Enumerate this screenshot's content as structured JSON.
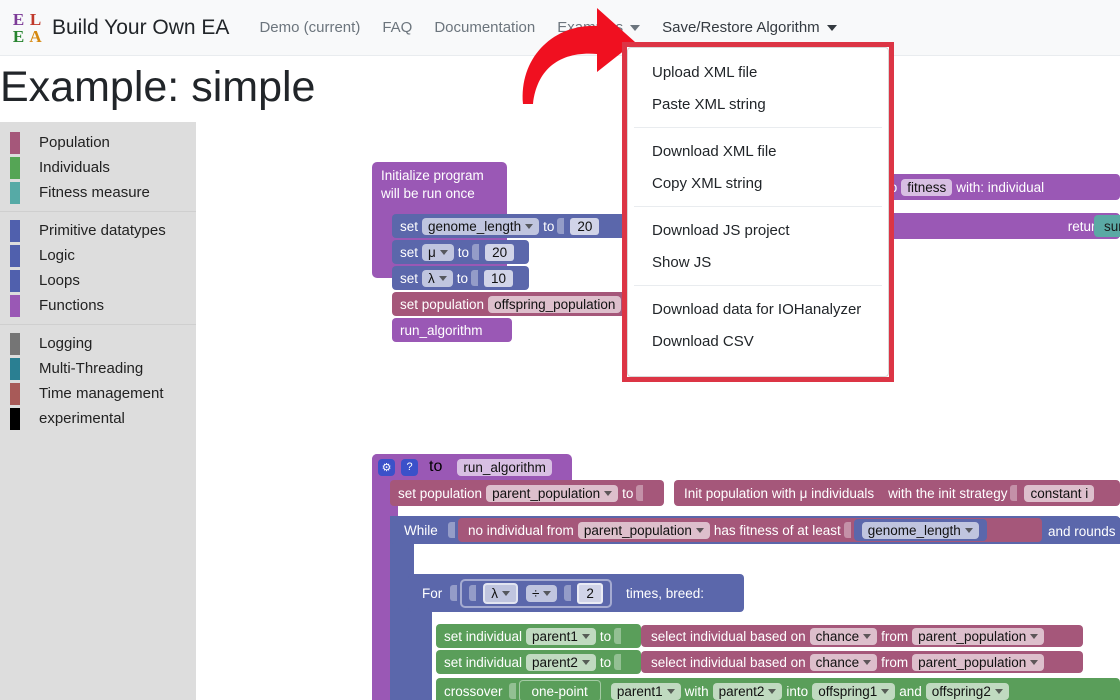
{
  "navbar": {
    "logo_letters": [
      {
        "ch": "E",
        "color": "#7d3c98"
      },
      {
        "ch": "L",
        "color": "#c0392b"
      },
      {
        "ch": "E",
        "color": "#27842f"
      },
      {
        "ch": "A",
        "color": "#d68910"
      }
    ],
    "brand": "Build Your Own EA",
    "links": [
      {
        "label": "Demo (current)",
        "dropdown": false
      },
      {
        "label": "FAQ",
        "dropdown": false
      },
      {
        "label": "Documentation",
        "dropdown": false
      },
      {
        "label": "Examples",
        "dropdown": true
      },
      {
        "label": "Save/Restore Algorithm",
        "dropdown": true
      }
    ]
  },
  "page": {
    "title": "Example: simple"
  },
  "dropdown": {
    "groups": [
      [
        "Upload XML file",
        "Paste XML string"
      ],
      [
        "Download XML file",
        "Copy XML string"
      ],
      [
        "Download JS project",
        "Show JS"
      ],
      [
        "Download data for IOHanalyzer",
        "Download CSV"
      ]
    ],
    "highlight_color": "#dc3545"
  },
  "sidebar": {
    "groups": [
      [
        {
          "label": "Population",
          "color": "#a5577a"
        },
        {
          "label": "Individuals",
          "color": "#55a555"
        },
        {
          "label": "Fitness measure",
          "color": "#56aaa6"
        }
      ],
      [
        {
          "label": "Primitive datatypes",
          "color": "#5060ad"
        },
        {
          "label": "Logic",
          "color": "#5060ad"
        },
        {
          "label": "Loops",
          "color": "#5060ad"
        },
        {
          "label": "Functions",
          "color": "#9a58b5"
        }
      ],
      [
        {
          "label": "Logging",
          "color": "#757575"
        },
        {
          "label": "Multi-Threading",
          "color": "#2a7f92"
        },
        {
          "label": "Time management",
          "color": "#a85a58"
        },
        {
          "label": "experimental",
          "color": "#000000"
        }
      ]
    ]
  },
  "workspace": {
    "init_block": {
      "title_line1": "Initialize program",
      "title_line2": "will be run once",
      "rows": {
        "set1_kw": "set",
        "set1_var": "genome_length",
        "set1_to": "to",
        "set1_val": "20",
        "set2_kw": "set",
        "set2_var": "μ",
        "set2_to": "to",
        "set2_val": "20",
        "set3_kw": "set",
        "set3_var": "λ",
        "set3_to": "to",
        "set3_val": "10",
        "setpop_kw": "set population",
        "setpop_var": "offspring_population",
        "call": "run_algorithm"
      }
    },
    "fitness_block": {
      "to": "to",
      "name": "fitness",
      "with": "with: individual"
    },
    "return_block": {
      "return": "return",
      "value": "sum"
    },
    "run_block": {
      "header_to": "to",
      "header_name": "run_algorithm",
      "setpop_kw": "set population",
      "setpop_var": "parent_population",
      "setpop_to": "to",
      "init_pop_text": "Init population with μ individuals",
      "init_strategy_label": "with the init strategy",
      "init_strategy_value": "constant i",
      "while_kw": "While",
      "while_cond_a": "no individual from",
      "while_cond_var": "parent_population",
      "while_cond_b": "has fitness of at least",
      "while_cond_val": "genome_length",
      "while_tail": "and rounds l",
      "for_kw": "For",
      "for_var": "λ",
      "for_op": "÷",
      "for_num": "2",
      "for_tail": "times, breed:",
      "sel1_kw": "set individual",
      "sel1_var": "parent1",
      "sel1_to": "to",
      "sel1_expr": "select individual based on",
      "sel1_mode": "chance",
      "sel1_from": "from",
      "sel1_src": "parent_population",
      "sel2_kw": "set individual",
      "sel2_var": "parent2",
      "sel2_to": "to",
      "sel2_expr": "select individual based on",
      "sel2_mode": "chance",
      "sel2_from": "from",
      "sel2_src": "parent_population",
      "cross_kw": "crossover",
      "cross_type": "one-point",
      "cross_p1": "parent1",
      "cross_with": "with",
      "cross_p2": "parent2",
      "cross_into": "into",
      "cross_o1": "offspring1",
      "cross_and": "and",
      "cross_o2": "offspring2"
    }
  }
}
